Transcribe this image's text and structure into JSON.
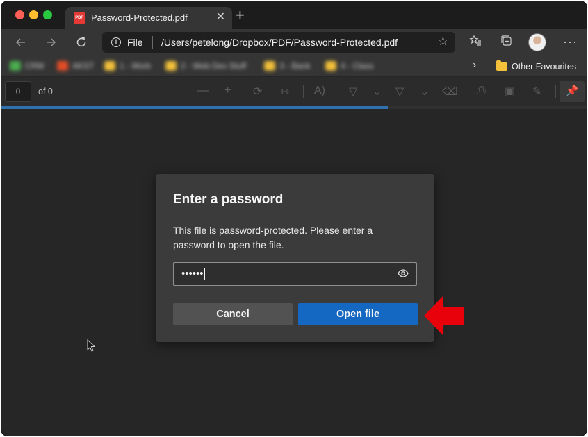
{
  "window": {
    "tab_title": "Password-Protected.pdf",
    "tab_close": "✕",
    "new_tab": "+",
    "pdf_badge": "PDF"
  },
  "address_bar": {
    "scheme_label": "File",
    "url": "/Users/petelong/Dropbox/PDF/Password-Protected.pdf"
  },
  "favourites_bar": {
    "items": [
      {
        "label": "CRM",
        "color": "#4caf50"
      },
      {
        "label": "AKST",
        "color": "#e44d26"
      },
      {
        "label": "1 - Work",
        "color": "#f3c13a"
      },
      {
        "label": "2 - Web Dev Stuff",
        "color": "#f3c13a"
      },
      {
        "label": "3 - Bank",
        "color": "#f3c13a"
      },
      {
        "label": "4 - Class",
        "color": "#f3c13a"
      }
    ],
    "overflow_chevron": "›",
    "other_favourites": "Other Favourites"
  },
  "pdf_toolbar": {
    "page_number": "0",
    "page_total": "of 0",
    "progress": 0.66
  },
  "dialog": {
    "title": "Enter a password",
    "message": "This file is password-protected. Please enter a password to open the file.",
    "password_masked": "••••••",
    "cancel_label": "Cancel",
    "open_label": "Open file"
  },
  "colors": {
    "accent": "#1468c2",
    "annotation_arrow": "#e8000b"
  },
  "icons": [
    "back-icon",
    "forward-icon",
    "refresh-icon",
    "info-icon",
    "star-icon",
    "favorites-icon",
    "collections-icon",
    "more-icon",
    "eye-icon",
    "pin-icon"
  ]
}
